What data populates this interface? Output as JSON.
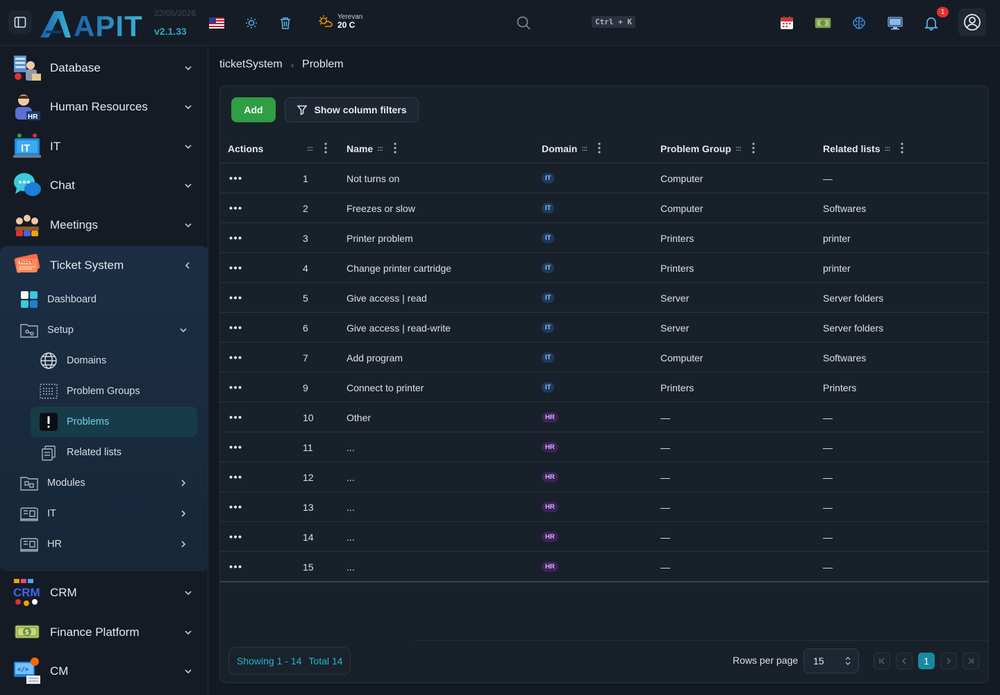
{
  "header": {
    "logo_text": "APIT",
    "date": "22/05/2026",
    "version": "v2.1.33",
    "weather": {
      "city": "Yerevan",
      "temp": "20 C"
    },
    "search_shortcut": "Ctrl + K",
    "notification_count": "1"
  },
  "sidebar": {
    "items_top": [
      {
        "label": "Database"
      },
      {
        "label": "Human Resources"
      },
      {
        "label": "IT"
      },
      {
        "label": "Chat"
      },
      {
        "label": "Meetings"
      }
    ],
    "ticket_system": {
      "label": "Ticket System",
      "sub": [
        {
          "label": "Dashboard"
        },
        {
          "label": "Setup"
        },
        {
          "label": "Domains"
        },
        {
          "label": "Problem Groups"
        },
        {
          "label": "Problems"
        },
        {
          "label": "Related lists"
        },
        {
          "label": "Modules"
        },
        {
          "label": "IT"
        },
        {
          "label": "HR"
        }
      ]
    },
    "items_bottom": [
      {
        "label": "CRM"
      },
      {
        "label": "Finance Platform"
      },
      {
        "label": "CM"
      }
    ]
  },
  "breadcrumb": {
    "parent": "ticketSystem",
    "current": "Problem"
  },
  "toolbar": {
    "add_label": "Add",
    "filters_label": "Show column filters"
  },
  "table": {
    "columns": {
      "actions": "Actions",
      "name": "Name",
      "domain": "Domain",
      "group": "Problem Group",
      "related": "Related lists"
    },
    "grip_symbol": ":::",
    "rows": [
      {
        "id": "1",
        "name": "Not turns on",
        "domain": "IT",
        "group": "Computer",
        "related": "—"
      },
      {
        "id": "2",
        "name": "Freezes or slow",
        "domain": "IT",
        "group": "Computer",
        "related": "Softwares"
      },
      {
        "id": "3",
        "name": "Printer problem",
        "domain": "IT",
        "group": "Printers",
        "related": "printer"
      },
      {
        "id": "4",
        "name": "Change printer cartridge",
        "domain": "IT",
        "group": "Printers",
        "related": "printer"
      },
      {
        "id": "5",
        "name": "Give access | read",
        "domain": "IT",
        "group": "Server",
        "related": "Server folders"
      },
      {
        "id": "6",
        "name": "Give access | read-write",
        "domain": "IT",
        "group": "Server",
        "related": "Server folders"
      },
      {
        "id": "7",
        "name": "Add program",
        "domain": "IT",
        "group": "Computer",
        "related": "Softwares"
      },
      {
        "id": "9",
        "name": "Connect to printer",
        "domain": "IT",
        "group": "Printers",
        "related": "Printers"
      },
      {
        "id": "10",
        "name": "Other",
        "domain": "HR",
        "group": "—",
        "related": "—"
      },
      {
        "id": "11",
        "name": "...",
        "domain": "HR",
        "group": "—",
        "related": "—"
      },
      {
        "id": "12",
        "name": "...",
        "domain": "HR",
        "group": "—",
        "related": "—"
      },
      {
        "id": "13",
        "name": "...",
        "domain": "HR",
        "group": "—",
        "related": "—"
      },
      {
        "id": "14",
        "name": "...",
        "domain": "HR",
        "group": "—",
        "related": "—"
      },
      {
        "id": "15",
        "name": "...",
        "domain": "HR",
        "group": "—",
        "related": "—"
      }
    ]
  },
  "footer": {
    "showing": "Showing 1 - 14",
    "total": "Total 14",
    "rows_per_page_label": "Rows per page",
    "rows_per_page_value": "15",
    "current_page": "1"
  },
  "colors": {
    "accent": "#22b8cf",
    "add_button": "#2f9e44",
    "notification": "#e03131",
    "tag_it": "#1d3a5c",
    "tag_hr": "#3b2356"
  },
  "icons": [
    "sidebar-toggle-icon",
    "us-flag-icon",
    "sun-icon",
    "trash-icon",
    "weather-icon",
    "search-icon",
    "calendar-icon",
    "money-icon",
    "brain-icon",
    "monitor-icon",
    "bell-icon",
    "user-circle-icon"
  ]
}
